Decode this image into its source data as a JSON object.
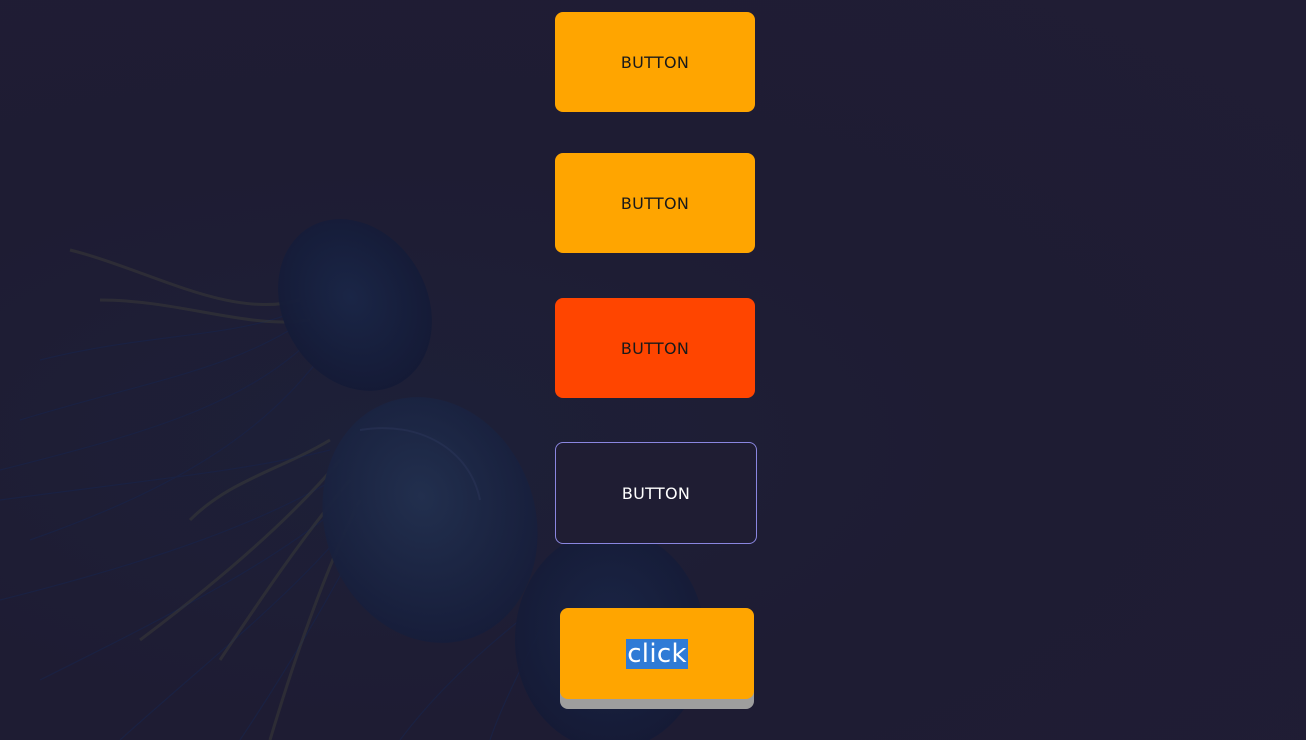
{
  "buttons": {
    "first_label": "BUTTON",
    "second_label": "BUTTON",
    "third_label": "BUTTON",
    "fourth_label": "BUTTON",
    "click_label": "click"
  },
  "colors": {
    "background": "#1f1d33",
    "orange": "#ffa500",
    "orange_red": "#ff4500",
    "outline": "#8a86e0",
    "press_shadow": "#9e9e9e",
    "text_selection": "#2f7bd6"
  },
  "background_image": "jellyfish"
}
